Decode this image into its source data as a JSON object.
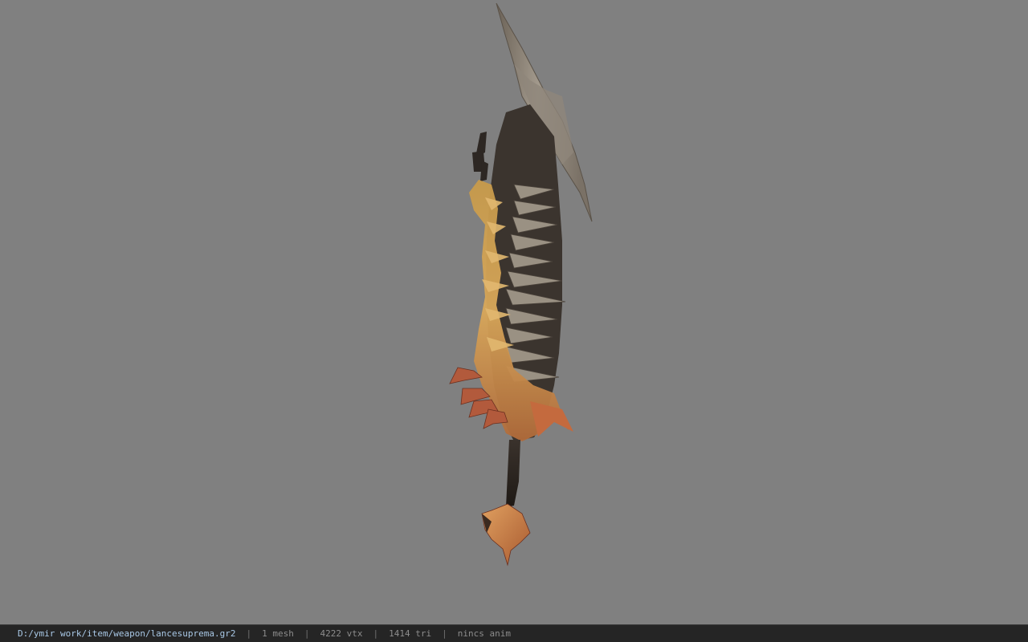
{
  "viewer": {
    "background_color": "#808080",
    "model_icon": "weapon-mesh"
  },
  "statusbar": {
    "file_path": "D:/ymir work/item/weapon/lancesuprema.gr2",
    "separator": "|",
    "mesh_count": "1 mesh",
    "vertex_count": "4222 vtx",
    "triangle_count": "1414 tri",
    "anim_status": "nincs anim"
  }
}
